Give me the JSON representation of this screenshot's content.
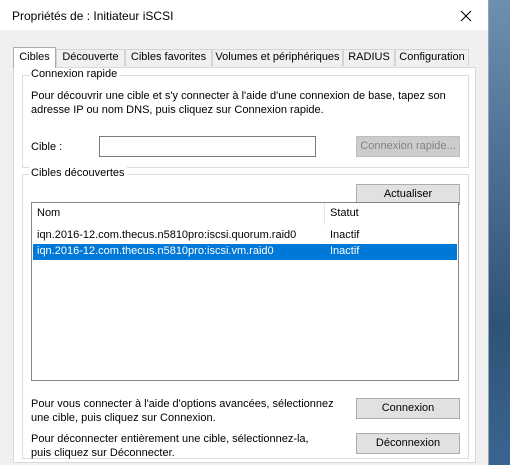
{
  "window": {
    "title": "Propriétés de : Initiateur iSCSI"
  },
  "tabs": [
    {
      "label": "Cibles"
    },
    {
      "label": "Découverte"
    },
    {
      "label": "Cibles favorites"
    },
    {
      "label": "Volumes et périphériques"
    },
    {
      "label": "RADIUS"
    },
    {
      "label": "Configuration"
    }
  ],
  "quick_connect": {
    "group_label": "Connexion rapide",
    "description_line1": "Pour découvrir une cible et s'y connecter à l'aide d'une connexion de base, tapez son",
    "description_line2": "adresse IP ou nom DNS, puis cliquez sur Connexion rapide.",
    "target_label": "Cible :",
    "target_value": "",
    "button_label": "Connexion rapide..."
  },
  "discovered": {
    "group_label": "Cibles découvertes",
    "refresh_button": "Actualiser",
    "columns": {
      "name": "Nom",
      "status": "Statut"
    },
    "rows": [
      {
        "name": "iqn.2016-12.com.thecus.n5810pro:iscsi.quorum.raid0",
        "status": "Inactif"
      },
      {
        "name": "iqn.2016-12.com.thecus.n5810pro:iscsi.vm.raid0",
        "status": "Inactif"
      }
    ],
    "selected_row": 1,
    "connect_help_line1": "Pour vous connecter à l'aide d'options avancées, sélectionnez",
    "connect_help_line2": "une cible, puis cliquez sur Connexion.",
    "connect_button": "Connexion",
    "disconnect_help_line1": "Pour déconnecter entièrement une cible, sélectionnez-la,",
    "disconnect_help_line2": "puis cliquez sur Déconnecter.",
    "disconnect_button": "Déconnexion"
  }
}
